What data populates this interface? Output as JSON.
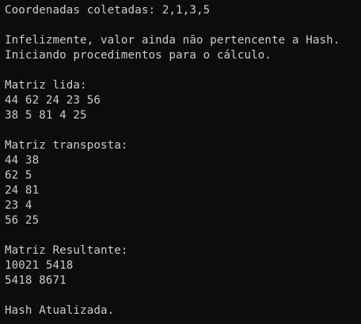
{
  "terminal": {
    "colors": {
      "background": "#0c0c0c",
      "foreground": "#cccccc"
    },
    "lines": [
      "Coordenadas coletadas: 2,1,3,5",
      "",
      "Infelizmente, valor ainda não pertencente a Hash.",
      "Iniciando procedimentos para o cálculo.",
      "",
      "Matriz lida:",
      "44 62 24 23 56",
      "38 5 81 4 25",
      "",
      "Matriz transposta:",
      "44 38",
      "62 5",
      "24 81",
      "23 4",
      "56 25",
      "",
      "Matriz Resultante:",
      "10021 5418",
      "5418 8671",
      "",
      "Hash Atualizada."
    ]
  }
}
